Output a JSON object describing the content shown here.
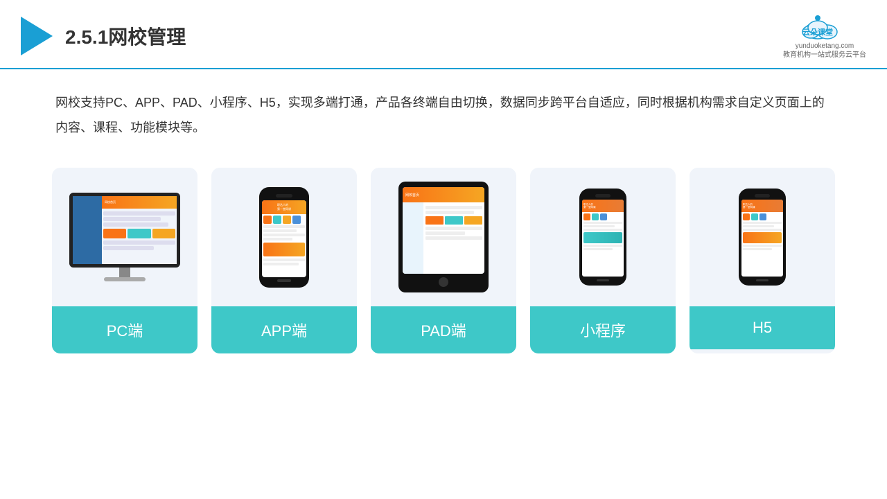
{
  "header": {
    "title": "2.5.1网校管理",
    "brand": {
      "name": "云朵课堂",
      "domain": "yunduoketang.com",
      "tagline": "教育机构一站\n式服务云平台"
    }
  },
  "description": {
    "text": "网校支持PC、APP、PAD、小程序、H5，实现多端打通，产品各终端自由切换，数据同步跨平台自适应，同时根据机构需求自定义页面上的内容、课程、功能模块等。"
  },
  "cards": [
    {
      "id": "pc",
      "label": "PC端",
      "device": "pc"
    },
    {
      "id": "app",
      "label": "APP端",
      "device": "phone"
    },
    {
      "id": "pad",
      "label": "PAD端",
      "device": "tablet"
    },
    {
      "id": "miniprogram",
      "label": "小程序",
      "device": "miniphone"
    },
    {
      "id": "h5",
      "label": "H5",
      "device": "miniphone2"
    }
  ],
  "colors": {
    "teal": "#3ec8c8",
    "blue": "#1a9fd4",
    "accent": "#f97316"
  }
}
